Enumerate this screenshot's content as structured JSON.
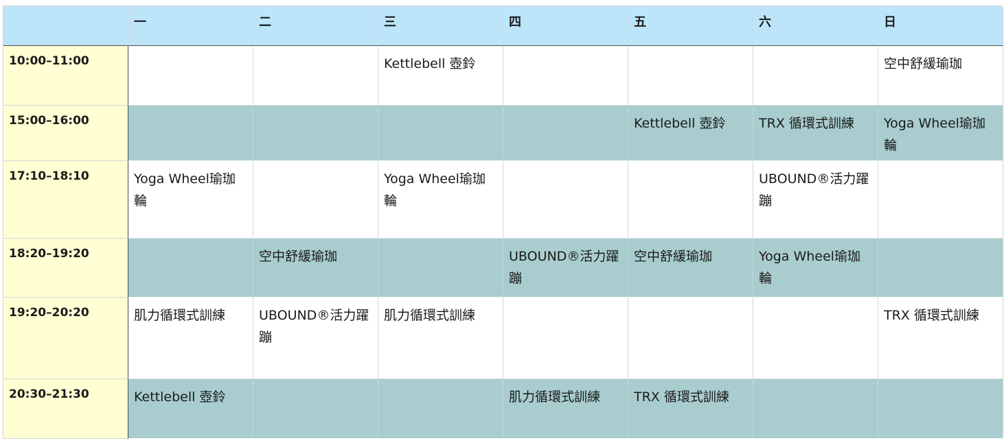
{
  "headers": [
    "",
    "一",
    "二",
    "三",
    "四",
    "五",
    "六",
    "日"
  ],
  "rows": [
    {
      "time": "10:00–11:00",
      "cells": [
        "",
        "",
        "Kettlebell 壺鈴",
        "",
        "",
        "",
        "空中舒緩瑜珈"
      ]
    },
    {
      "time": "15:00–16:00",
      "cells": [
        "",
        "",
        "",
        "",
        "Kettlebell 壺鈴",
        "TRX 循環式訓練",
        "Yoga Wheel瑜珈輪"
      ]
    },
    {
      "time": "17:10–18:10",
      "cells": [
        "Yoga Wheel瑜珈輪",
        "",
        "Yoga Wheel瑜珈輪",
        "",
        "",
        "UBOUND®活力躍蹦",
        ""
      ]
    },
    {
      "time": "18:20–19:20",
      "cells": [
        "",
        "空中舒緩瑜珈",
        "",
        "UBOUND®活力躍蹦",
        "空中舒緩瑜珈",
        "Yoga Wheel瑜珈輪",
        ""
      ]
    },
    {
      "time": "19:20–20:20",
      "cells": [
        "肌力循環式訓練",
        "UBOUND®活力躍蹦",
        "肌力循環式訓練",
        "",
        "",
        "",
        "TRX 循環式訓練"
      ]
    },
    {
      "time": "20:30–21:30",
      "cells": [
        "Kettlebell 壺鈴",
        "",
        "",
        "肌力循環式訓練",
        "TRX 循環式訓練",
        "",
        ""
      ]
    }
  ]
}
